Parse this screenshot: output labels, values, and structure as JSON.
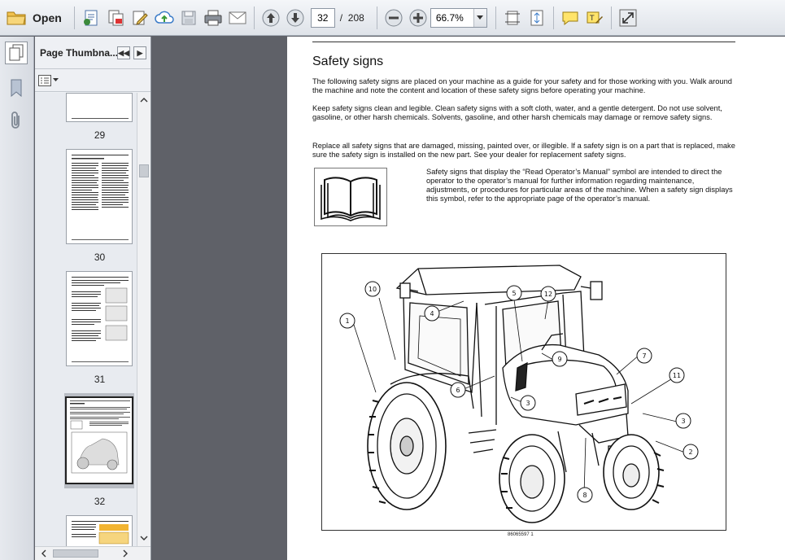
{
  "toolbar": {
    "open_label": "Open",
    "page_current": "32",
    "page_separator": "/",
    "page_total": "208",
    "zoom_value": "66.7%"
  },
  "panel": {
    "title": "Page Thumbna...",
    "thumbnails": [
      {
        "label": "29"
      },
      {
        "label": "30"
      },
      {
        "label": "31"
      },
      {
        "label": "32"
      }
    ]
  },
  "document": {
    "heading": "Safety signs",
    "paragraphs": [
      "The following safety signs are placed on your machine as a guide for your safety and for those working with you. Walk around the machine and note the content and location of these safety signs before operating your machine.",
      "Keep safety signs clean and legible.  Clean safety signs with a soft cloth, water, and a gentle detergent.  Do not use solvent, gasoline, or other harsh chemicals.  Solvents, gasoline, and other harsh chemicals may damage or remove safety signs.",
      "Replace all safety signs that are damaged, missing, painted over, or illegible.  If a safety sign is on a part that is replaced, make sure the safety sign is installed on the new part.  See your dealer for replacement safety signs."
    ],
    "read_manual_text": "Safety signs that display the “Read Operator’s Manual” symbol are intended to direct the operator to the operator’s manual for further information regarding maintenance, adjustments, or procedures for particular areas of the machine. When a safety sign displays this symbol, refer to the appropriate page of the operator’s manual.",
    "figure_callouts": [
      "1",
      "2",
      "3",
      "3",
      "4",
      "5",
      "6",
      "7",
      "8",
      "9",
      "10",
      "11",
      "12"
    ],
    "figure_caption": "86065597    1"
  },
  "colors": {
    "toolbar_bg": "#e6e9ee",
    "doc_bg": "#5f6168",
    "accent": "#1c5fa8"
  }
}
